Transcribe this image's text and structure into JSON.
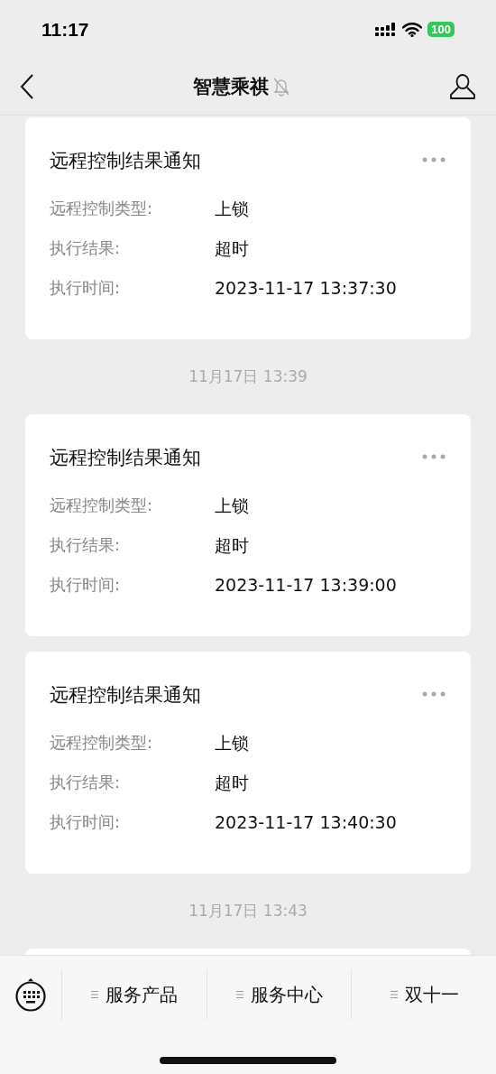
{
  "status_bar": {
    "time": "11:17",
    "battery": "100"
  },
  "nav": {
    "title": "智慧乘祺",
    "muted": true
  },
  "messages": [
    {
      "kind": "notice",
      "title": "远程控制结果通知",
      "fields": [
        {
          "label": "远程控制类型:",
          "value": "上锁"
        },
        {
          "label": "执行结果:",
          "value": "超时"
        },
        {
          "label": "执行时间:",
          "value": "2023-11-17 13:37:30"
        }
      ]
    },
    {
      "kind": "time",
      "text": "11月17日 13:39"
    },
    {
      "kind": "notice",
      "title": "远程控制结果通知",
      "fields": [
        {
          "label": "远程控制类型:",
          "value": "上锁"
        },
        {
          "label": "执行结果:",
          "value": "超时"
        },
        {
          "label": "执行时间:",
          "value": "2023-11-17 13:39:00"
        }
      ]
    },
    {
      "kind": "notice",
      "title": "远程控制结果通知",
      "fields": [
        {
          "label": "远程控制类型:",
          "value": "上锁"
        },
        {
          "label": "执行结果:",
          "value": "超时"
        },
        {
          "label": "执行时间:",
          "value": "2023-11-17 13:40:30"
        }
      ]
    },
    {
      "kind": "time",
      "text": "11月17日 13:43"
    },
    {
      "kind": "card_edge"
    }
  ],
  "menu": [
    "服务产品",
    "服务中心",
    "双十一"
  ]
}
